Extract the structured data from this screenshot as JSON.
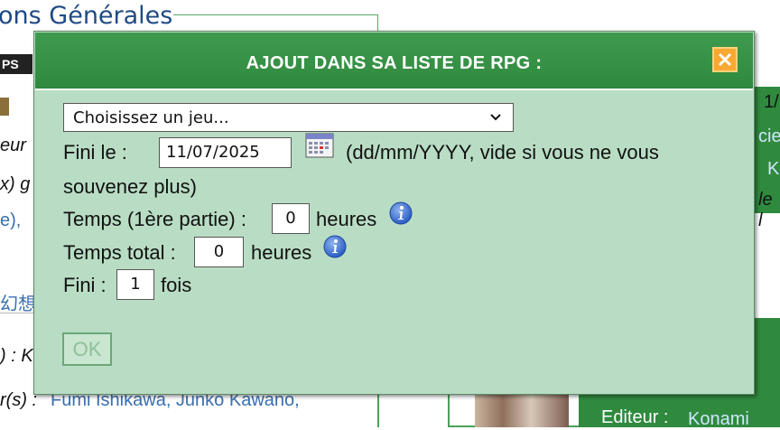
{
  "background": {
    "section_title": "ons Générales",
    "badge": "PS",
    "left_texts": [
      "eur",
      "x) g",
      "e),",
      "幻想",
      ") : K",
      "r(s) :"
    ],
    "credits_link": "Fumi Ishikawa, Junko Kawano,",
    "right_texts": [
      "1/",
      "cie",
      "K",
      "le l"
    ],
    "editor_label": "Editeur :",
    "editor_value": "Konami"
  },
  "modal": {
    "title": "AJOUT DANS SA LISTE DE RPG :",
    "game_select": {
      "selected": "Choisissez un jeu..."
    },
    "finished_label": "Fini le :",
    "finished_date": "11/07/2025",
    "date_hint_line1": "(dd/mm/YYYY, vide si vous ne vous",
    "date_hint_line2": "souvenez plus)",
    "first_time_label": "Temps (1ère partie) :",
    "first_time_value": "0",
    "first_time_unit": "heures",
    "total_time_label": "Temps total :",
    "total_time_value": "0",
    "total_time_unit": "heures",
    "times_label": "Fini :",
    "times_value": "1",
    "times_unit": "fois",
    "ok_label": "OK"
  },
  "icons": {
    "close": "close-icon",
    "calendar": "calendar-icon",
    "info": "info-icon",
    "chevron": "chevron-down-icon"
  },
  "colors": {
    "header_green": "#2f8a3e",
    "modal_bg": "#b9ddc4",
    "close_orange": "#f9a832",
    "info_blue": "#3b6fd0"
  }
}
